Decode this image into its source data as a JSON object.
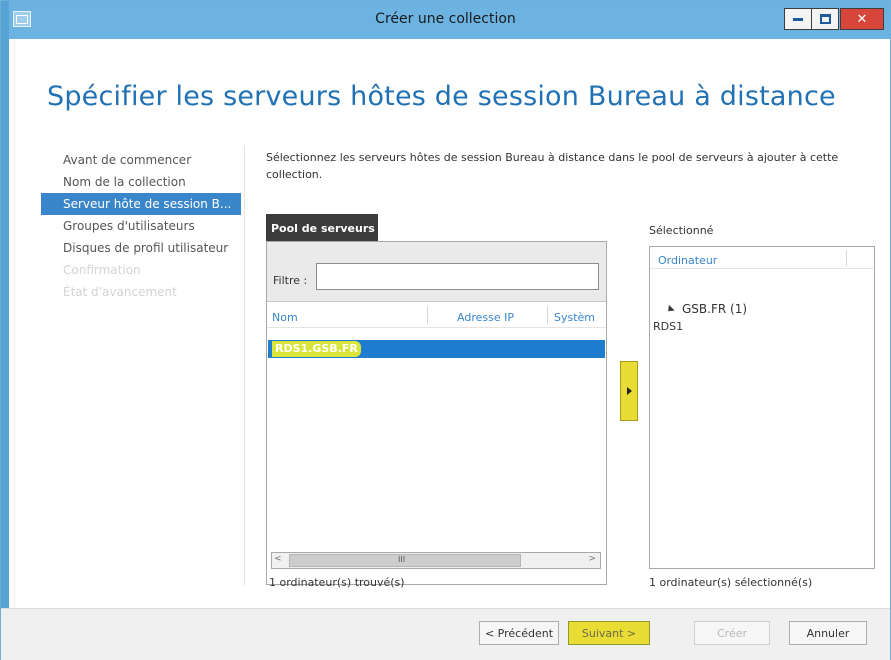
{
  "window": {
    "title": "Créer une collection"
  },
  "page_title": "Spécifier les serveurs hôtes de session Bureau à distance",
  "nav": {
    "items": [
      {
        "label": "Avant de commencer",
        "state": "normal"
      },
      {
        "label": "Nom de la collection",
        "state": "normal"
      },
      {
        "label": "Serveur hôte de session B...",
        "state": "active"
      },
      {
        "label": "Groupes d'utilisateurs",
        "state": "normal"
      },
      {
        "label": "Disques de profil utilisateur",
        "state": "normal"
      },
      {
        "label": "Confirmation",
        "state": "disabled"
      },
      {
        "label": "État d'avancement",
        "state": "disabled"
      }
    ]
  },
  "description": "Sélectionnez les serveurs hôtes de session Bureau à distance dans le pool de serveurs à ajouter à cette collection.",
  "pool": {
    "tab_label": "Pool de serveurs",
    "filter_label": "Filtre :",
    "filter_value": "",
    "columns": [
      "Nom",
      "Adresse IP",
      "Systèm"
    ],
    "rows": [
      {
        "name": "RDS1.GSB.FR",
        "ip": "",
        "system": "",
        "selected": true
      }
    ],
    "scroll_grip": "III",
    "count_text": "1 ordinateur(s) trouvé(s)"
  },
  "selected": {
    "label": "Sélectionné",
    "column": "Ordinateur",
    "group": "GSB.FR (1)",
    "server": "RDS1",
    "count_text": "1 ordinateur(s) sélectionné(s)"
  },
  "footer": {
    "prev_label": "< Précédent",
    "next_label": "Suivant >",
    "create_label": "Créer",
    "cancel_label": "Annuler"
  },
  "colors": {
    "titlebar": "#6cb3e2",
    "accent": "#2171b5",
    "nav_active": "#3a86cb",
    "selection": "#1f7dd0",
    "highlight": "#e9dd35"
  },
  "icons": [
    "window-app-icon",
    "minimize-icon",
    "maximize-icon",
    "close-icon",
    "expand-triangle-icon",
    "add-arrow-icon"
  ]
}
